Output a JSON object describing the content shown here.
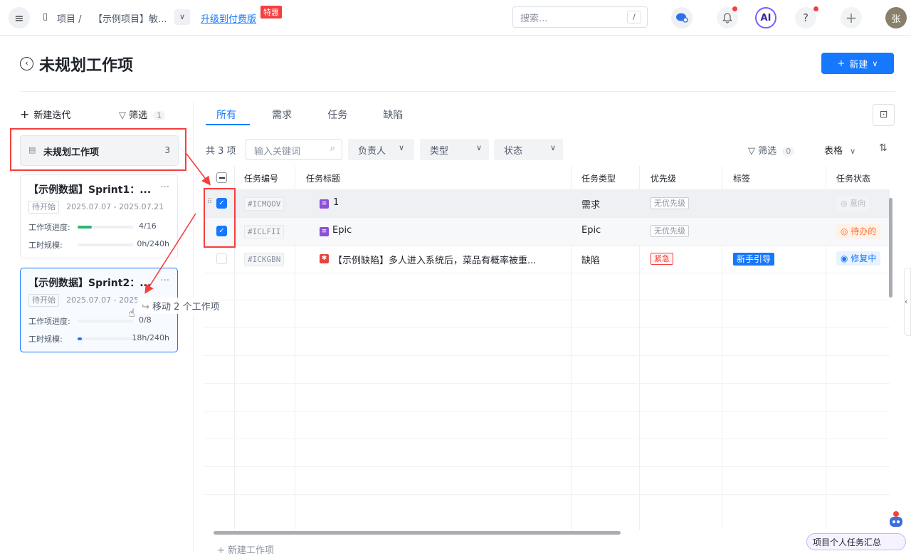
{
  "topbar": {
    "breadcrumb_project": "项目 /",
    "breadcrumb_current": "【示例项目】敏...",
    "upgrade_label": "升级到付费版",
    "promo_badge": "特惠",
    "search_placeholder": "搜索...",
    "search_shortcut": "/",
    "ai_label": "AI",
    "help_label": "?",
    "add_label": "+",
    "avatar_text": "张"
  },
  "page": {
    "title": "未规划工作项",
    "new_button": "新建"
  },
  "sidebar": {
    "new_iteration": "新建迭代",
    "filter_label": "筛选",
    "filter_count": "1",
    "unplanned_label": "未规划工作项",
    "unplanned_count": "3",
    "sprints": [
      {
        "title": "【示例数据】Sprint1：...",
        "status": "待开始",
        "dates": "2025.07.07 - 2025.07.21",
        "progress_label": "工作项进度:",
        "progress_value": "4/16",
        "progress_fraction": 0.25,
        "effort_label": "工时规模:",
        "effort_value": "0h/240h",
        "effort_fraction": 0.0
      },
      {
        "title": "【示例数据】Sprint2：...",
        "status": "待开始",
        "dates": "2025.07.07 - 2025",
        "progress_label": "工作项进度:",
        "progress_value": "0/8",
        "progress_fraction": 0.0,
        "effort_label": "工时规模:",
        "effort_value": "18h/240h",
        "effort_fraction": 0.075
      }
    ],
    "drag_tooltip": "移动 2 个工作项"
  },
  "tabs": [
    "所有",
    "需求",
    "任务",
    "缺陷"
  ],
  "toolbar": {
    "total": "共 3 项",
    "keyword_placeholder": "输入关键词",
    "assignee": "负责人",
    "type": "类型",
    "status": "状态",
    "filter_label": "筛选",
    "filter_count": "0",
    "view_label": "表格"
  },
  "table": {
    "columns": [
      "任务编号",
      "任务标题",
      "任务类型",
      "优先级",
      "标签",
      "任务状态"
    ],
    "rows": [
      {
        "checked": true,
        "id": "#ICMQOV",
        "title": "1",
        "type_icon": "requirement-icon",
        "type": "需求",
        "priority": "无优先级",
        "tag": "",
        "status": "意向"
      },
      {
        "checked": true,
        "id": "#ICLFII",
        "title": "Epic",
        "type_icon": "requirement-icon",
        "type": "Epic",
        "priority": "无优先级",
        "tag": "",
        "status": "待办的"
      },
      {
        "checked": false,
        "id": "#ICKGBN",
        "title": "【示例缺陷】多人进入系统后，菜品有概率被重...",
        "type_icon": "bug-icon",
        "type": "缺陷",
        "priority": "紧急",
        "tag": "新手引导",
        "status": "修复中"
      }
    ],
    "new_item": "新建工作项"
  },
  "footer": {
    "task_summary": "项目个人任务汇总"
  },
  "colors": {
    "accent": "#1677ff",
    "danger": "#f53f3f",
    "progress_green": "#2bb673"
  }
}
